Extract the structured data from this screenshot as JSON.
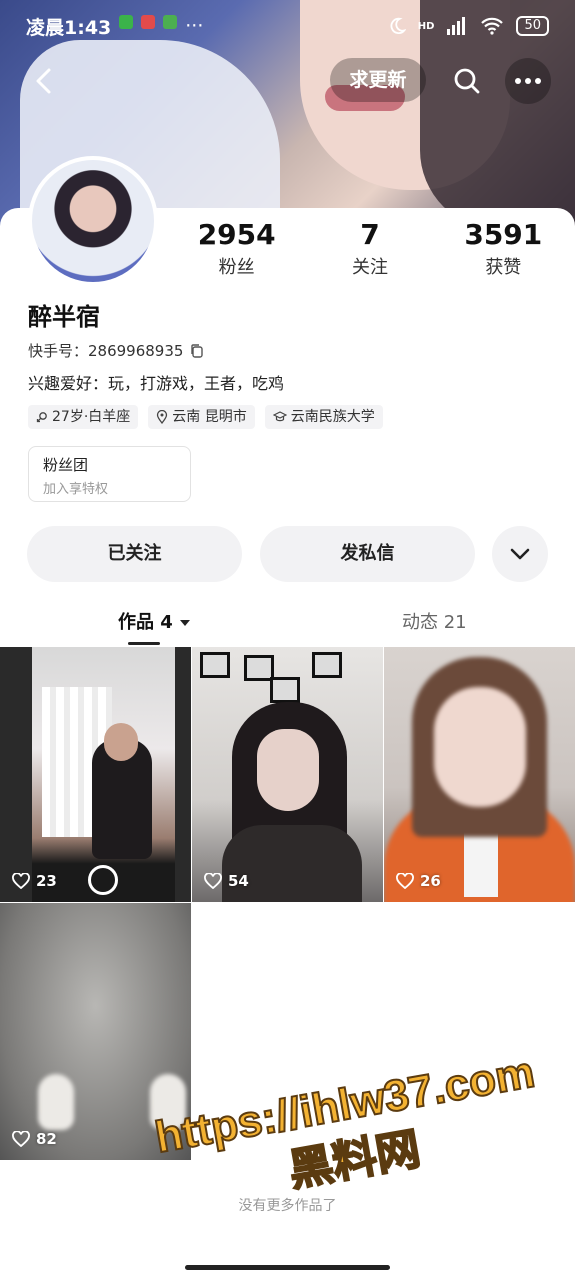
{
  "status_bar": {
    "time": "凌晨1:43",
    "more": "···",
    "network": "HD",
    "battery": "50"
  },
  "top_nav": {
    "update_button": "求更新"
  },
  "stats": [
    {
      "value": "2954",
      "label": "粉丝"
    },
    {
      "value": "7",
      "label": "关注"
    },
    {
      "value": "3591",
      "label": "获赞"
    }
  ],
  "profile": {
    "name": "醉半宿",
    "uid": "快手号：2869968935",
    "bio": "兴趣爱好：玩，打游戏，王者，吃鸡",
    "tags": [
      "27岁·白羊座",
      "云南 昆明市",
      "云南民族大学"
    ]
  },
  "fanclub": {
    "title": "粉丝团",
    "subtitle": "加入享特权"
  },
  "actions": {
    "follow": "已关注",
    "message": "发私信"
  },
  "tabs": {
    "works": "作品 4",
    "moments": "动态 21"
  },
  "posts": [
    {
      "likes": "23"
    },
    {
      "likes": "54"
    },
    {
      "likes": "26"
    },
    {
      "likes": "82"
    }
  ],
  "footer": {
    "no_more": "没有更多作品了"
  },
  "watermark": {
    "url": "https://ihlw37.com",
    "name": "黑料网"
  },
  "colors": {
    "accent": "#222222",
    "pill_bg": "#f2f2f4",
    "watermark": "#f3b232"
  }
}
